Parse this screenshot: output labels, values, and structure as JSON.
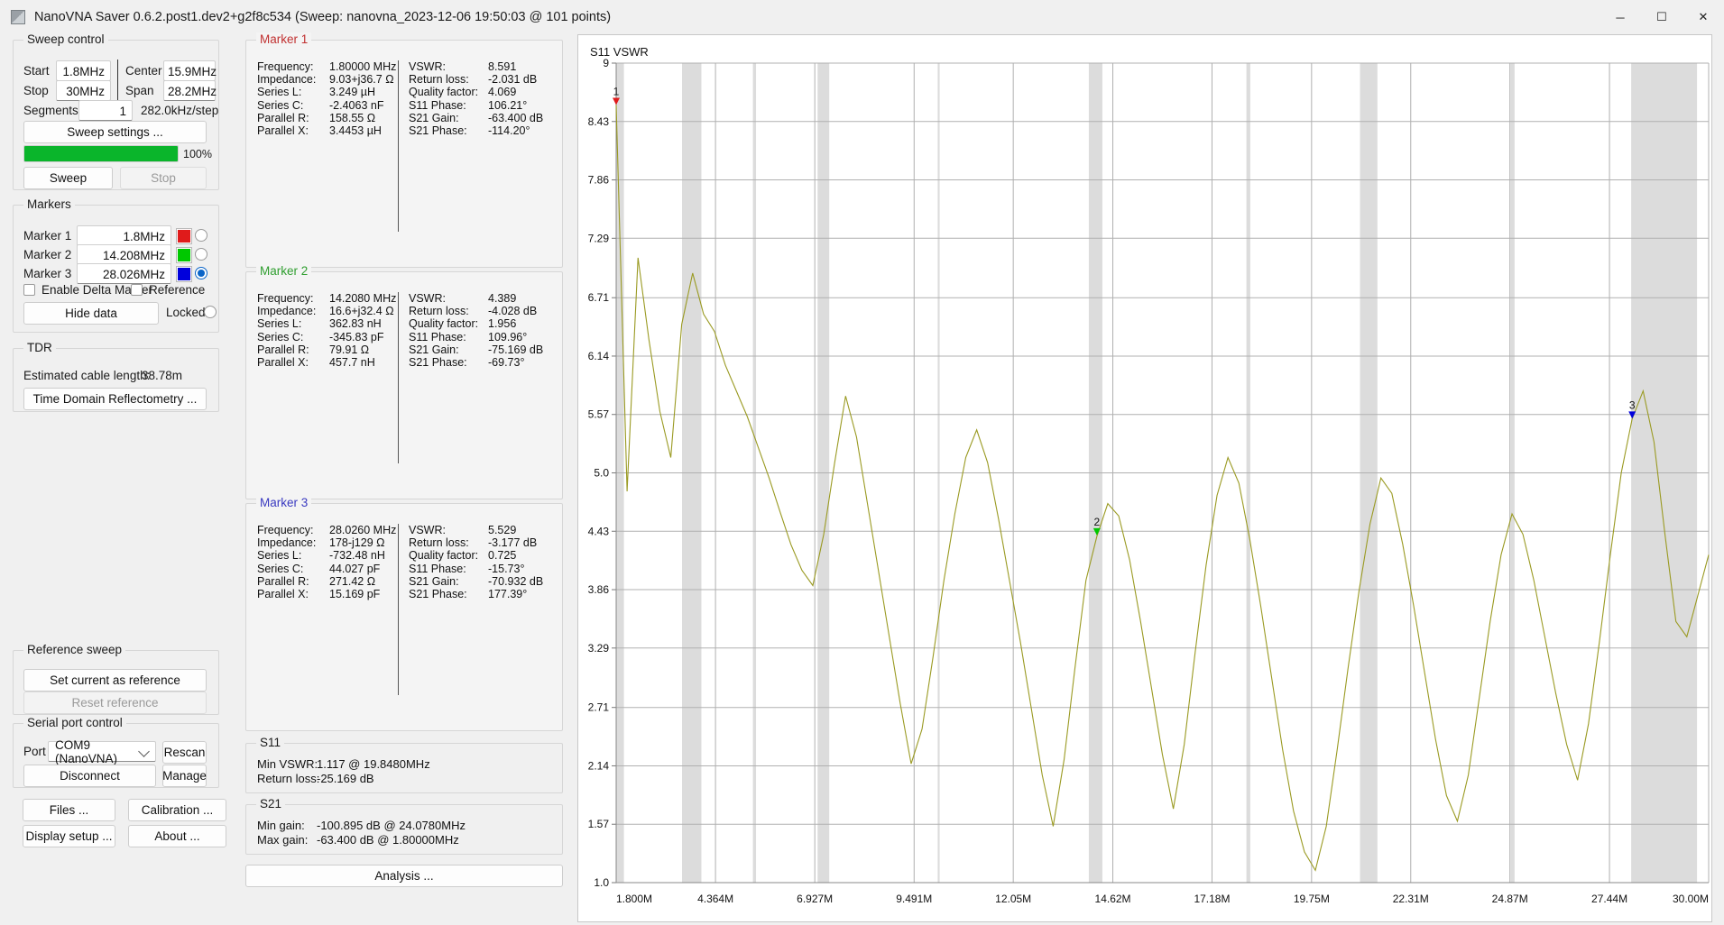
{
  "window": {
    "title": "NanoVNA Saver 0.6.2.post1.dev2+g2f8c534 (Sweep: nanovna_2023-12-06 19:50:03 @ 101 points)",
    "minimize": "─",
    "maximize": "☐",
    "close": "✕"
  },
  "sweep_control": {
    "title": "Sweep control",
    "start_label": "Start",
    "start_value": "1.8MHz",
    "stop_label": "Stop",
    "stop_value": "30MHz",
    "center_label": "Center",
    "center_value": "15.9MHz",
    "span_label": "Span",
    "span_value": "28.2MHz",
    "segments_label": "Segments",
    "segments_value": "1",
    "step_info": "282.0kHz/step",
    "sweep_settings_button": "Sweep settings ...",
    "progress_text": "100%",
    "progress_percent": 100,
    "sweep_button": "Sweep",
    "stop_button": "Stop"
  },
  "markers_panel": {
    "title": "Markers",
    "rows": [
      {
        "label": "Marker 1",
        "value": "1.8MHz",
        "color": "#e01b1b",
        "selected": false
      },
      {
        "label": "Marker 2",
        "value": "14.208MHz",
        "color": "#00c800",
        "selected": false
      },
      {
        "label": "Marker 3",
        "value": "28.026MHz",
        "color": "#0000dc",
        "selected": true
      }
    ],
    "delta_label": "Enable Delta Marker",
    "reference_label": "Reference",
    "hide_data_button": "Hide data",
    "locked_label": "Locked"
  },
  "tdr": {
    "title": "TDR",
    "cable_label": "Estimated cable length:",
    "cable_value": "38.78m",
    "button": "Time Domain Reflectometry ..."
  },
  "reference_sweep": {
    "title": "Reference sweep",
    "set_button": "Set current as reference",
    "reset_button": "Reset reference"
  },
  "serial_port": {
    "title": "Serial port control",
    "port_label": "Port",
    "port_value": "COM9 (NanoVNA)",
    "rescan_button": "Rescan",
    "disconnect_button": "Disconnect",
    "manage_button": "Manage"
  },
  "bottom_buttons": {
    "files": "Files ...",
    "calibration": "Calibration ...",
    "display_setup": "Display setup ...",
    "about": "About ...",
    "analysis": "Analysis ..."
  },
  "marker1": {
    "title": "Marker 1",
    "color": "#c03030",
    "left": [
      {
        "key": "Frequency:",
        "value": "1.80000 MHz"
      },
      {
        "key": "Impedance:",
        "value": "9.03+j36.7 Ω"
      },
      {
        "key": "Series L:",
        "value": "3.249 µH"
      },
      {
        "key": "Series C:",
        "value": "-2.4063 nF"
      },
      {
        "key": "Parallel R:",
        "value": "158.55 Ω"
      },
      {
        "key": "Parallel X:",
        "value": "3.4453 µH"
      }
    ],
    "right": [
      {
        "key": "VSWR:",
        "value": "8.591"
      },
      {
        "key": "Return loss:",
        "value": "-2.031 dB"
      },
      {
        "key": "Quality factor:",
        "value": "4.069"
      },
      {
        "key": "S11 Phase:",
        "value": "106.21°"
      },
      {
        "key": "S21 Gain:",
        "value": "-63.400 dB"
      },
      {
        "key": "S21 Phase:",
        "value": "-114.20°"
      }
    ]
  },
  "marker2": {
    "title": "Marker 2",
    "color": "#2f9e2f",
    "left": [
      {
        "key": "Frequency:",
        "value": "14.2080 MHz"
      },
      {
        "key": "Impedance:",
        "value": "16.6+j32.4 Ω"
      },
      {
        "key": "Series L:",
        "value": "362.83 nH"
      },
      {
        "key": "Series C:",
        "value": "-345.83 pF"
      },
      {
        "key": "Parallel R:",
        "value": "79.91 Ω"
      },
      {
        "key": "Parallel X:",
        "value": "457.7 nH"
      }
    ],
    "right": [
      {
        "key": "VSWR:",
        "value": "4.389"
      },
      {
        "key": "Return loss:",
        "value": "-4.028 dB"
      },
      {
        "key": "Quality factor:",
        "value": "1.956"
      },
      {
        "key": "S11 Phase:",
        "value": "109.96°"
      },
      {
        "key": "S21 Gain:",
        "value": "-75.169 dB"
      },
      {
        "key": "S21 Phase:",
        "value": "-69.73°"
      }
    ]
  },
  "marker3": {
    "title": "Marker 3",
    "color": "#3a3ac0",
    "left": [
      {
        "key": "Frequency:",
        "value": "28.0260 MHz"
      },
      {
        "key": "Impedance:",
        "value": "178-j129 Ω"
      },
      {
        "key": "Series L:",
        "value": "-732.48 nH"
      },
      {
        "key": "Series C:",
        "value": "44.027 pF"
      },
      {
        "key": "Parallel R:",
        "value": "271.42 Ω"
      },
      {
        "key": "Parallel X:",
        "value": "15.169 pF"
      }
    ],
    "right": [
      {
        "key": "VSWR:",
        "value": "5.529"
      },
      {
        "key": "Return loss:",
        "value": "-3.177 dB"
      },
      {
        "key": "Quality factor:",
        "value": "0.725"
      },
      {
        "key": "S11 Phase:",
        "value": "-15.73°"
      },
      {
        "key": "S21 Gain:",
        "value": "-70.932 dB"
      },
      {
        "key": "S21 Phase:",
        "value": "177.39°"
      }
    ]
  },
  "s11_summary": {
    "title": "S11",
    "lines": [
      {
        "key": "Min VSWR:",
        "value": "1.117 @ 19.8480MHz"
      },
      {
        "key": "Return loss:",
        "value": "-25.169 dB"
      }
    ]
  },
  "s21_summary": {
    "title": "S21",
    "lines": [
      {
        "key": "Min gain:",
        "value": "-100.895 dB @ 24.0780MHz"
      },
      {
        "key": "Max gain:",
        "value": "-63.400 dB @ 1.80000MHz"
      }
    ]
  },
  "chart_data": {
    "type": "line",
    "title": "S11 VSWR",
    "xlabel": "",
    "ylabel": "VSWR",
    "grid": true,
    "legend": false,
    "trace_color": "#9a9a22",
    "xlim": [
      1.8,
      30.0
    ],
    "ylim": [
      1.0,
      9.0
    ],
    "ytick_labels": [
      "9",
      "8.43",
      "7.86",
      "7.29",
      "6.71",
      "6.14",
      "5.57",
      "5.0",
      "4.43",
      "3.86",
      "3.29",
      "2.71",
      "2.14",
      "1.57",
      "1.0"
    ],
    "ytick_values": [
      9.0,
      8.43,
      7.86,
      7.29,
      6.71,
      6.14,
      5.57,
      5.0,
      4.43,
      3.86,
      3.29,
      2.71,
      2.14,
      1.57,
      1.0
    ],
    "xtick_labels": [
      "1.800M",
      "4.364M",
      "6.927M",
      "9.491M",
      "12.05M",
      "14.62M",
      "17.18M",
      "19.75M",
      "22.31M",
      "24.87M",
      "27.44M",
      "30.00M"
    ],
    "xtick_values": [
      1.8,
      4.364,
      6.927,
      9.491,
      12.05,
      14.62,
      17.18,
      19.75,
      22.31,
      24.87,
      27.44,
      30.0
    ],
    "bands": [
      [
        1.8,
        2.0
      ],
      [
        3.5,
        4.0
      ],
      [
        5.33,
        5.41
      ],
      [
        7.0,
        7.3
      ],
      [
        10.1,
        10.15
      ],
      [
        14.0,
        14.35
      ],
      [
        18.068,
        18.168
      ],
      [
        21.0,
        21.45
      ],
      [
        24.89,
        24.99
      ],
      [
        28.0,
        29.7
      ]
    ],
    "markers": [
      {
        "label": "1",
        "frequency": 1.8,
        "vswr": 8.591,
        "color": "#e01b1b"
      },
      {
        "label": "2",
        "frequency": 14.208,
        "vswr": 4.389,
        "color": "#00c800"
      },
      {
        "label": "3",
        "frequency": 28.026,
        "vswr": 5.529,
        "color": "#0000dc"
      }
    ],
    "x": [
      1.8,
      2.082,
      2.364,
      2.646,
      2.928,
      3.21,
      3.492,
      3.774,
      4.056,
      4.338,
      4.62,
      4.902,
      5.184,
      5.466,
      5.748,
      6.03,
      6.312,
      6.594,
      6.876,
      7.158,
      7.44,
      7.722,
      8.004,
      8.286,
      8.568,
      8.85,
      9.132,
      9.414,
      9.696,
      9.978,
      10.26,
      10.542,
      10.824,
      11.106,
      11.388,
      11.67,
      11.952,
      12.234,
      12.516,
      12.798,
      13.08,
      13.362,
      13.644,
      13.926,
      14.208,
      14.49,
      14.772,
      15.054,
      15.336,
      15.618,
      15.9,
      16.182,
      16.464,
      16.746,
      17.028,
      17.31,
      17.592,
      17.874,
      18.156,
      18.438,
      18.72,
      19.002,
      19.284,
      19.566,
      19.848,
      20.13,
      20.412,
      20.694,
      20.976,
      21.258,
      21.54,
      21.822,
      22.104,
      22.386,
      22.668,
      22.95,
      23.232,
      23.514,
      23.796,
      24.078,
      24.36,
      24.642,
      24.924,
      25.206,
      25.488,
      25.77,
      26.052,
      26.334,
      26.616,
      26.898,
      27.18,
      27.462,
      27.744,
      28.026,
      28.308,
      28.59,
      28.872,
      29.154,
      29.436,
      29.718,
      30.0
    ],
    "y": [
      8.591,
      4.82,
      7.1,
      6.3,
      5.6,
      5.15,
      6.45,
      6.95,
      6.55,
      6.38,
      6.05,
      5.8,
      5.55,
      5.25,
      4.95,
      4.62,
      4.3,
      4.05,
      3.9,
      4.4,
      5.1,
      5.75,
      5.35,
      4.7,
      4.05,
      3.4,
      2.75,
      2.16,
      2.5,
      3.2,
      3.95,
      4.6,
      5.15,
      5.42,
      5.1,
      4.55,
      3.95,
      3.35,
      2.7,
      2.05,
      1.55,
      2.2,
      3.1,
      3.95,
      4.38,
      4.7,
      4.58,
      4.15,
      3.55,
      2.9,
      2.25,
      1.72,
      2.35,
      3.25,
      4.1,
      4.78,
      5.15,
      4.9,
      4.35,
      3.7,
      3.0,
      2.3,
      1.7,
      1.3,
      1.12,
      1.55,
      2.3,
      3.1,
      3.85,
      4.5,
      4.95,
      4.8,
      4.3,
      3.7,
      3.05,
      2.4,
      1.85,
      1.6,
      2.05,
      2.8,
      3.55,
      4.2,
      4.6,
      4.4,
      3.95,
      3.4,
      2.85,
      2.35,
      2.0,
      2.55,
      3.35,
      4.2,
      5.0,
      5.529,
      5.8,
      5.3,
      4.4,
      3.55,
      3.4,
      3.8,
      4.2
    ]
  }
}
